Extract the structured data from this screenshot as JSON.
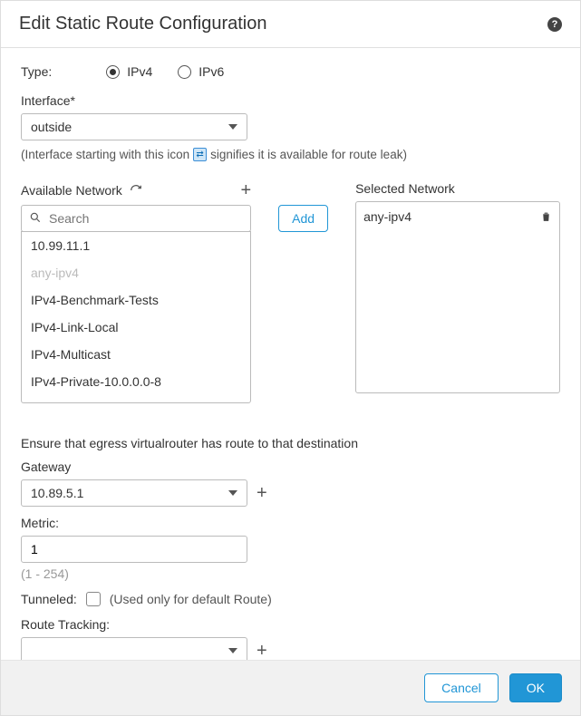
{
  "header": {
    "title": "Edit Static Route Configuration"
  },
  "type": {
    "label": "Type:",
    "options": {
      "ipv4": "IPv4",
      "ipv6": "IPv6"
    },
    "selected": "ipv4"
  },
  "interface": {
    "label": "Interface*",
    "value": "outside",
    "hint_prefix": "(Interface starting with this icon",
    "hint_suffix": "signifies it is available for route leak)"
  },
  "available": {
    "label": "Available Network",
    "search_placeholder": "Search",
    "items": [
      {
        "label": "10.99.11.1",
        "disabled": false
      },
      {
        "label": "any-ipv4",
        "disabled": true
      },
      {
        "label": "IPv4-Benchmark-Tests",
        "disabled": false
      },
      {
        "label": "IPv4-Link-Local",
        "disabled": false
      },
      {
        "label": "IPv4-Multicast",
        "disabled": false
      },
      {
        "label": "IPv4-Private-10.0.0.0-8",
        "disabled": false
      }
    ]
  },
  "add_button": "Add",
  "selected_network": {
    "label": "Selected Network",
    "items": [
      "any-ipv4"
    ]
  },
  "egress_note": "Ensure that egress virtualrouter has route to that destination",
  "gateway": {
    "label": "Gateway",
    "value": "10.89.5.1"
  },
  "metric": {
    "label": "Metric:",
    "value": "1",
    "range": "(1 - 254)"
  },
  "tunneled": {
    "label": "Tunneled:",
    "note": "(Used only for default Route)",
    "checked": false
  },
  "route_tracking": {
    "label": "Route Tracking:",
    "value": ""
  },
  "footer": {
    "cancel": "Cancel",
    "ok": "OK"
  }
}
